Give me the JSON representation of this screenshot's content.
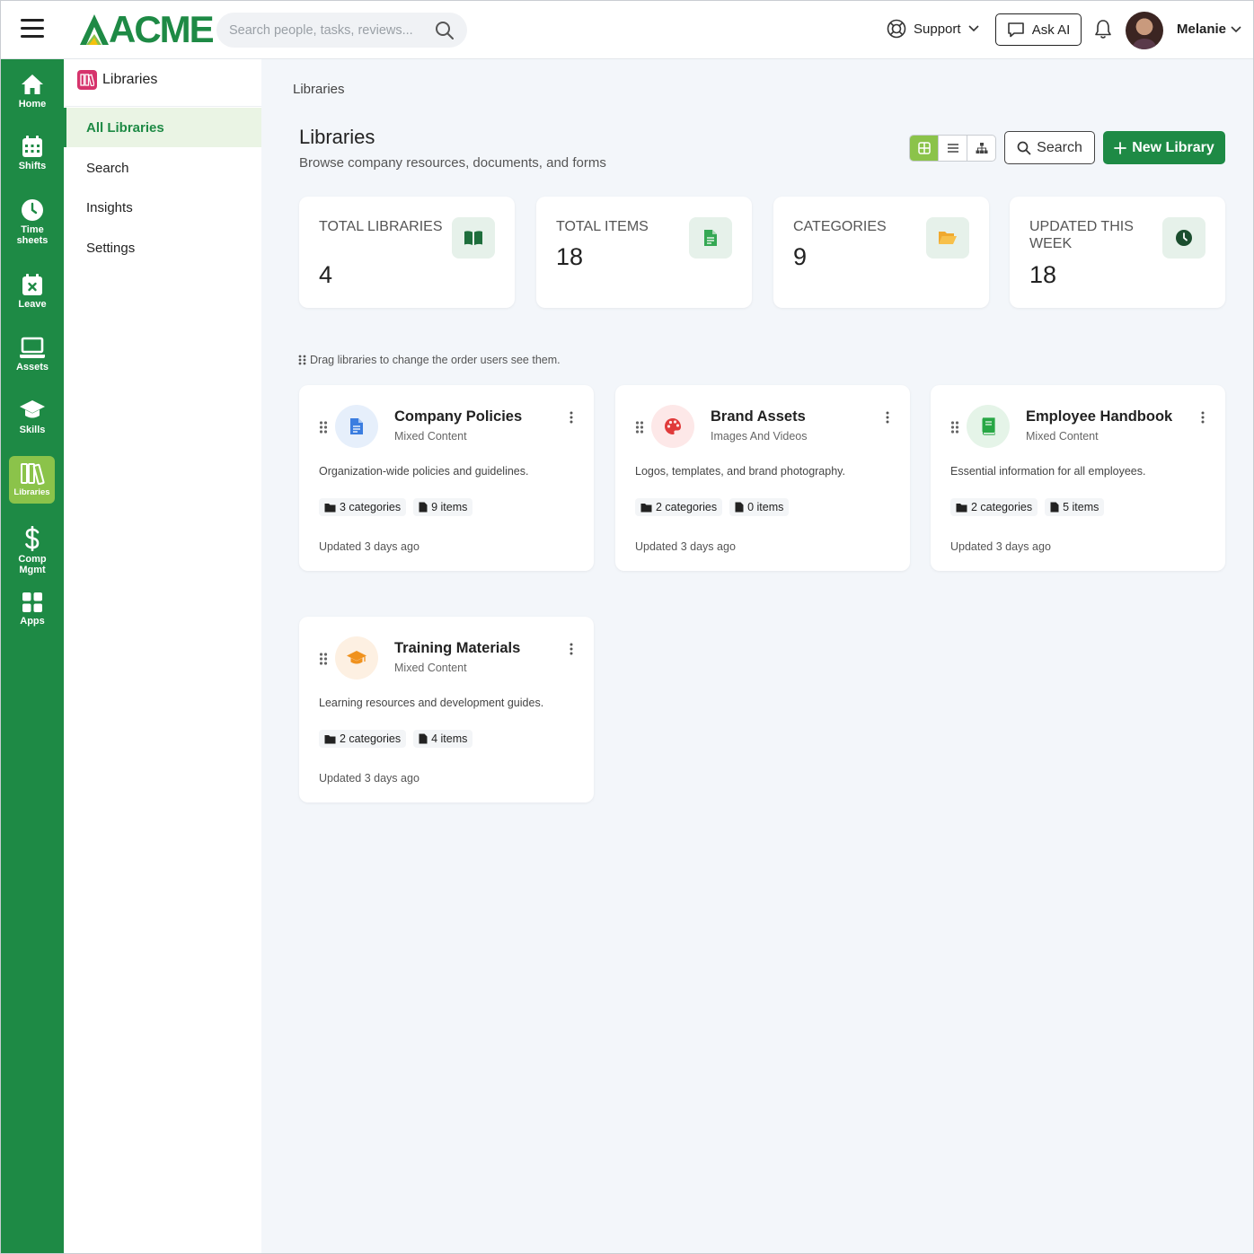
{
  "topbar": {
    "logo": "ACME",
    "search_placeholder": "Search people, tasks, reviews...",
    "support_label": "Support",
    "ask_ai_label": "Ask AI",
    "user_name": "Melanie"
  },
  "rail": [
    {
      "label": "Home",
      "icon": "home-icon"
    },
    {
      "label": "Shifts",
      "icon": "calendar-icon"
    },
    {
      "label": "Time sheets",
      "icon": "clock-icon"
    },
    {
      "label": "Leave",
      "icon": "calendar-x-icon"
    },
    {
      "label": "Assets",
      "icon": "laptop-icon"
    },
    {
      "label": "Skills",
      "icon": "graduation-cap-icon"
    },
    {
      "label": "Libraries",
      "icon": "books-icon",
      "active": true
    },
    {
      "label": "Comp Mgmt",
      "icon": "dollar-icon"
    },
    {
      "label": "Apps",
      "icon": "grid-icon"
    }
  ],
  "subnav": {
    "title": "Libraries",
    "items": [
      {
        "label": "All Libraries",
        "active": true
      },
      {
        "label": "Search"
      },
      {
        "label": "Insights"
      },
      {
        "label": "Settings"
      }
    ]
  },
  "main": {
    "breadcrumb": "Libraries",
    "title": "Libraries",
    "subtitle": "Browse company resources, documents, and forms",
    "search_button": "Search",
    "new_button": "New Library",
    "drag_hint": "Drag libraries to change the order users see them."
  },
  "stats": [
    {
      "label": "TOTAL LIBRARIES",
      "value": "4",
      "icon": "book-open-icon"
    },
    {
      "label": "TOTAL ITEMS",
      "value": "18",
      "icon": "file-icon"
    },
    {
      "label": "CATEGORIES",
      "value": "9",
      "icon": "folder-open-icon"
    },
    {
      "label": "UPDATED THIS WEEK",
      "value": "18",
      "icon": "clock-icon"
    }
  ],
  "libraries": [
    {
      "title": "Company Policies",
      "type": "Mixed Content",
      "description": "Organization-wide policies and guidelines.",
      "categories": "3 categories",
      "items": "9 items",
      "updated": "Updated 3 days ago",
      "icon": "document-icon",
      "icon_color": "#3b7de0",
      "icon_bg": "#e6effb"
    },
    {
      "title": "Brand Assets",
      "type": "Images And Videos",
      "description": "Logos, templates, and brand photography.",
      "categories": "2 categories",
      "items": "0 items",
      "updated": "Updated 3 days ago",
      "icon": "palette-icon",
      "icon_color": "#e03b3b",
      "icon_bg": "#fde8e8"
    },
    {
      "title": "Employee Handbook",
      "type": "Mixed Content",
      "description": "Essential information for all employees.",
      "categories": "2 categories",
      "items": "5 items",
      "updated": "Updated 3 days ago",
      "icon": "book-icon",
      "icon_color": "#28a745",
      "icon_bg": "#e5f4e8"
    },
    {
      "title": "Training Materials",
      "type": "Mixed Content",
      "description": "Learning resources and development guides.",
      "categories": "2 categories",
      "items": "4 items",
      "updated": "Updated 3 days ago",
      "icon": "graduation-cap-icon",
      "icon_color": "#f0921e",
      "icon_bg": "#fdf0e2"
    }
  ],
  "colors": {
    "brand": "#1e8a45",
    "accent": "#8bc34a"
  }
}
